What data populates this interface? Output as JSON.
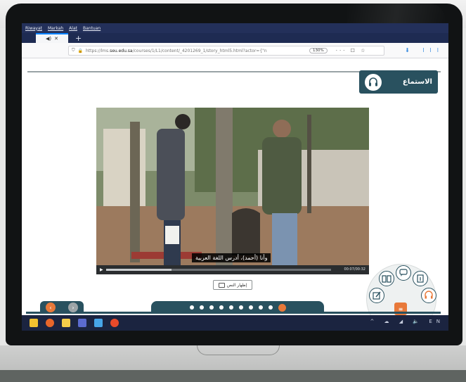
{
  "menu": {
    "items": [
      "Riwayat",
      "Markah",
      "Alat",
      "Bantuan"
    ]
  },
  "browser": {
    "tab_close": "✕",
    "new_tab": "+",
    "url_prefix": "https://lms.",
    "url_host": "seu.edu.sa",
    "url_rest": "/courses/1/L1/content/_4201269_1/story_html5.html?actor={\"n",
    "zoom": "130%",
    "url_actions": "··· ☐ ☆",
    "toolbar_right": "⬇ lll"
  },
  "section": {
    "title": "الاستماع",
    "icon": "headphones-icon"
  },
  "video": {
    "subtitle": "وأنا (أحمد)، أدرس اللغة العربية",
    "time": "00:07/00:32",
    "progress": 0.29
  },
  "show_text_button": {
    "label": "إظهار النص",
    "icon": "document-icon"
  },
  "nav": {
    "prev": "‹",
    "next": "›"
  },
  "pager": {
    "count": 10,
    "active_index": 9
  },
  "skills_menu": {
    "items": [
      {
        "icon": "reading-book-icon"
      },
      {
        "icon": "speaking-icon"
      },
      {
        "icon": "grammar-icon"
      },
      {
        "icon": "writing-icon"
      },
      {
        "icon": "headphones-icon"
      }
    ],
    "center_icon": "menu-icon"
  },
  "colors": {
    "accent": "#29515f",
    "highlight": "#e8793a",
    "browser_chrome": "#23305a"
  },
  "taskbar": {
    "tray": "^ ☁ ◢ 🔈 EN",
    "apps": [
      "store-icon",
      "firefox-icon",
      "files-icon",
      "teams-icon",
      "monitor-icon",
      "browser-icon"
    ]
  }
}
